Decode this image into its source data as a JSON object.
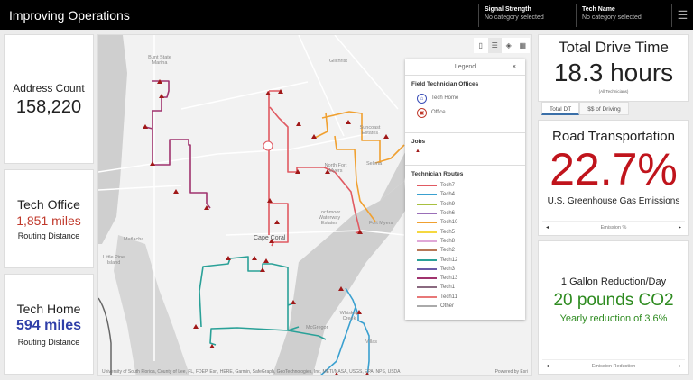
{
  "header": {
    "title": "Improving Operations",
    "filters": [
      {
        "label": "Signal Strength",
        "value": "No category selected"
      },
      {
        "label": "Tech Name",
        "value": "No category selected"
      }
    ],
    "menu_icon": "hamburger-icon"
  },
  "left_cards": [
    {
      "title": "Address Count",
      "value": "158,220",
      "subtitle": "",
      "color": "#222222"
    },
    {
      "title": "Tech Office",
      "value": "1,851 miles",
      "subtitle": "Routing Distance",
      "color": "#c0392b"
    },
    {
      "title": "Tech Home",
      "value": "594 miles",
      "subtitle": "Routing Distance",
      "color": "#2f3fa8"
    }
  ],
  "map": {
    "tools": [
      "bookmark-icon",
      "legend-icon",
      "layers-icon",
      "basemap-icon"
    ],
    "labels": {
      "bunt": "Bunt State Marina",
      "gilchrist": "Gilchrist",
      "suncoast": "Suncoast Estates",
      "tice": "Selena",
      "nfm": "North Fort Myers",
      "lochmoor": "Lochmoor Waterway Estates",
      "fortmyers": "Fort Myers",
      "capecoral": "Cape Coral",
      "matlacha": "Matlacha",
      "littlepine": "Little Pine Island",
      "whiskey": "Whiskey Creek",
      "villas": "Villas",
      "mcgregor": "McGregor"
    },
    "attribution": "University of South Florida, County of Lee, FL, FDEP, Esri, HERE, Garmin, SafeGraph, GeoTechnologies, Inc, METI/NASA, USGS, EPA, NPS, USDA",
    "powered_by": "Powered by Esri",
    "legend": {
      "title": "Legend",
      "close": "×",
      "offices_title": "Field Technician Offices",
      "offices": [
        {
          "label": "Tech Home",
          "color": "#3b4fb8"
        },
        {
          "label": "Office",
          "color": "#c0392b"
        }
      ],
      "jobs_title": "Jobs",
      "routes_title": "Technician Routes",
      "routes": [
        {
          "label": "Tech7",
          "color": "#e05a62"
        },
        {
          "label": "Tech4",
          "color": "#3aa0d0"
        },
        {
          "label": "Tech9",
          "color": "#a8c040"
        },
        {
          "label": "Tech6",
          "color": "#9a6fb8"
        },
        {
          "label": "Tech10",
          "color": "#f0a030"
        },
        {
          "label": "Tech5",
          "color": "#f5d840"
        },
        {
          "label": "Tech8",
          "color": "#e0a8d8"
        },
        {
          "label": "Tech2",
          "color": "#b87858"
        },
        {
          "label": "Tech12",
          "color": "#2aa198"
        },
        {
          "label": "Tech3",
          "color": "#6a5aa8"
        },
        {
          "label": "Tech13",
          "color": "#a0336e"
        },
        {
          "label": "Tech1",
          "color": "#8a6a80"
        },
        {
          "label": "Tech11",
          "color": "#e87878"
        },
        {
          "label": "Other",
          "color": "#aaaaaa"
        }
      ]
    }
  },
  "right": {
    "drive": {
      "title": "Total Drive Time",
      "value": "18.3 hours",
      "note": "(All Technicians)"
    },
    "tabs": [
      "Total DT",
      "$$ of Driving"
    ],
    "road": {
      "title": "Road Transportation",
      "value": "22.7%",
      "subtitle": "U.S. Greenhouse Gas Emissions",
      "nav": "Emission %"
    },
    "gallon": {
      "title": "1 Gallon Reduction/Day",
      "value": "20 pounds CO2",
      "subtitle": "Yearly reduction of 3.6%",
      "nav": "Emission Reduction"
    }
  }
}
